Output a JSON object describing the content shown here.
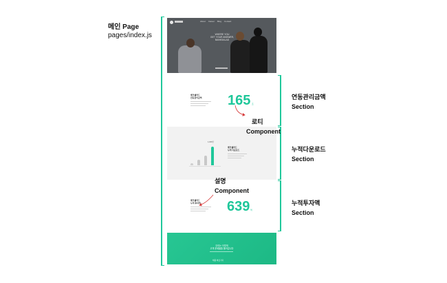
{
  "page": {
    "title": "메인 Page",
    "path": "pages/index.js"
  },
  "hero": {
    "headline_lines": [
      "WHERE YOU",
      "GET YOUR ANSWER,",
      "BANKSALAD"
    ],
    "nav_items": [
      "About",
      "Career",
      "Blog",
      "Contact"
    ]
  },
  "sections": [
    {
      "title": "연동관리금액",
      "suffix": "Section"
    },
    {
      "title": "누적다운로드",
      "suffix": "Section"
    },
    {
      "title": "누적투자액",
      "suffix": "Section"
    }
  ],
  "components": [
    {
      "title": "로티",
      "suffix": "Component"
    },
    {
      "title": "설명",
      "suffix": "Component"
    }
  ],
  "mock_sections": {
    "managed": {
      "heading_lines": [
        "뱅크샐러드",
        "연동관리금액"
      ],
      "value": "165",
      "unit": "조"
    },
    "downloads": {
      "heading_lines": [
        "뱅크샐러드",
        "누적 다운로드"
      ],
      "bars": [
        0.12,
        0.28,
        0.45,
        0.9
      ],
      "badge": "1,000만"
    },
    "invested": {
      "heading_lines": [
        "뱅크샐러드",
        "누적 투자액"
      ],
      "value": "639",
      "unit": "억"
    },
    "footer": {
      "lines": [
        "우리는 이렇게",
        "고객 문제들을 풀어갑니다"
      ],
      "button": "채용 바로가기"
    }
  },
  "colors": {
    "accent": "#1fc79a",
    "footer_bg": "#24c08e",
    "hero_bg": "#55595d",
    "gray_section": "#f2f2f2"
  }
}
